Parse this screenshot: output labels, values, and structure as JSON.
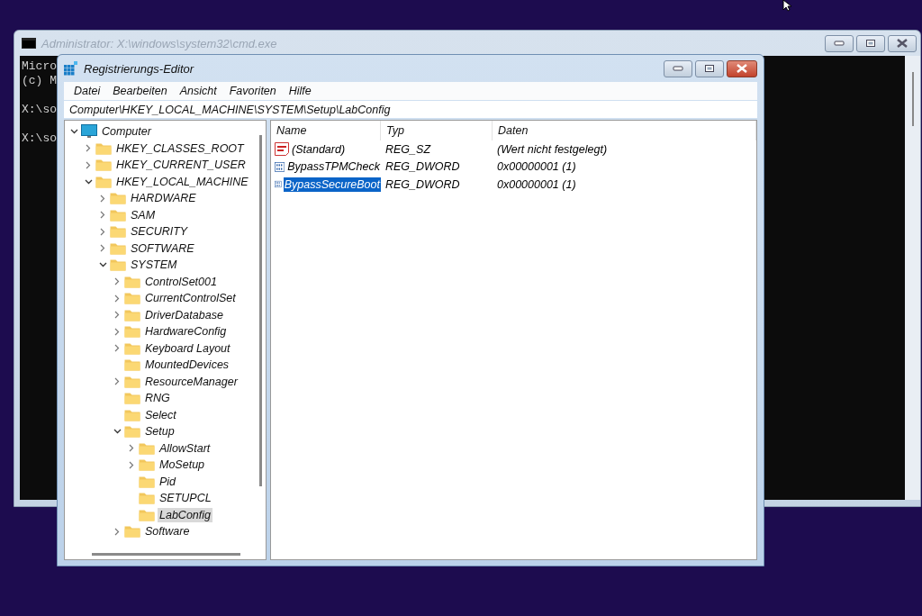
{
  "console": {
    "title": "Administrator: X:\\windows\\system32\\cmd.exe",
    "lines": [
      "Micro",
      "(c) M",
      "X:\\so",
      "X:\\so"
    ]
  },
  "regedit": {
    "title": "Registrierungs-Editor",
    "menu": [
      "Datei",
      "Bearbeiten",
      "Ansicht",
      "Favoriten",
      "Hilfe"
    ],
    "address": "Computer\\HKEY_LOCAL_MACHINE\\SYSTEM\\Setup\\LabConfig",
    "tree": [
      {
        "label": "Computer",
        "kind": "computer",
        "expanded": true,
        "selected": false,
        "children": [
          {
            "label": "HKEY_CLASSES_ROOT",
            "kind": "folder",
            "expanded": false,
            "selected": false
          },
          {
            "label": "HKEY_CURRENT_USER",
            "kind": "folder",
            "expanded": false,
            "selected": false
          },
          {
            "label": "HKEY_LOCAL_MACHINE",
            "kind": "folder",
            "expanded": true,
            "selected": false,
            "children": [
              {
                "label": "HARDWARE",
                "kind": "folder",
                "expanded": false,
                "selected": false
              },
              {
                "label": "SAM",
                "kind": "folder",
                "expanded": false,
                "selected": false
              },
              {
                "label": "SECURITY",
                "kind": "folder",
                "expanded": false,
                "selected": false
              },
              {
                "label": "SOFTWARE",
                "kind": "folder",
                "expanded": false,
                "selected": false
              },
              {
                "label": "SYSTEM",
                "kind": "folder",
                "expanded": true,
                "selected": false,
                "children": [
                  {
                    "label": "ControlSet001",
                    "kind": "folder",
                    "expanded": false,
                    "selected": false
                  },
                  {
                    "label": "CurrentControlSet",
                    "kind": "folder",
                    "expanded": false,
                    "selected": false
                  },
                  {
                    "label": "DriverDatabase",
                    "kind": "folder",
                    "expanded": false,
                    "selected": false
                  },
                  {
                    "label": "HardwareConfig",
                    "kind": "folder",
                    "expanded": false,
                    "selected": false
                  },
                  {
                    "label": "Keyboard Layout",
                    "kind": "folder",
                    "expanded": false,
                    "selected": false
                  },
                  {
                    "label": "MountedDevices",
                    "kind": "folder",
                    "selected": false
                  },
                  {
                    "label": "ResourceManager",
                    "kind": "folder",
                    "expanded": false,
                    "selected": false
                  },
                  {
                    "label": "RNG",
                    "kind": "folder",
                    "selected": false
                  },
                  {
                    "label": "Select",
                    "kind": "folder",
                    "selected": false
                  },
                  {
                    "label": "Setup",
                    "kind": "folder",
                    "expanded": true,
                    "selected": false,
                    "children": [
                      {
                        "label": "AllowStart",
                        "kind": "folder",
                        "expanded": false,
                        "selected": false
                      },
                      {
                        "label": "MoSetup",
                        "kind": "folder",
                        "expanded": false,
                        "selected": false
                      },
                      {
                        "label": "Pid",
                        "kind": "folder",
                        "selected": false
                      },
                      {
                        "label": "SETUPCL",
                        "kind": "folder",
                        "selected": false
                      },
                      {
                        "label": "LabConfig",
                        "kind": "folder",
                        "selected": true
                      }
                    ]
                  },
                  {
                    "label": "Software",
                    "kind": "folder",
                    "expanded": false,
                    "selected": false
                  }
                ]
              }
            ]
          }
        ]
      }
    ],
    "columns": [
      "Name",
      "Typ",
      "Daten"
    ],
    "rows": [
      {
        "kind": "string",
        "name": "(Standard)",
        "type": "REG_SZ",
        "data": "(Wert nicht festgelegt)",
        "selected": false
      },
      {
        "kind": "binary",
        "name": "BypassTPMCheck",
        "type": "REG_DWORD",
        "data": "0x00000001 (1)",
        "selected": false
      },
      {
        "kind": "binary",
        "name": "BypassSecureBoot",
        "type": "REG_DWORD",
        "data": "0x00000001 (1)",
        "selected": true
      }
    ]
  }
}
